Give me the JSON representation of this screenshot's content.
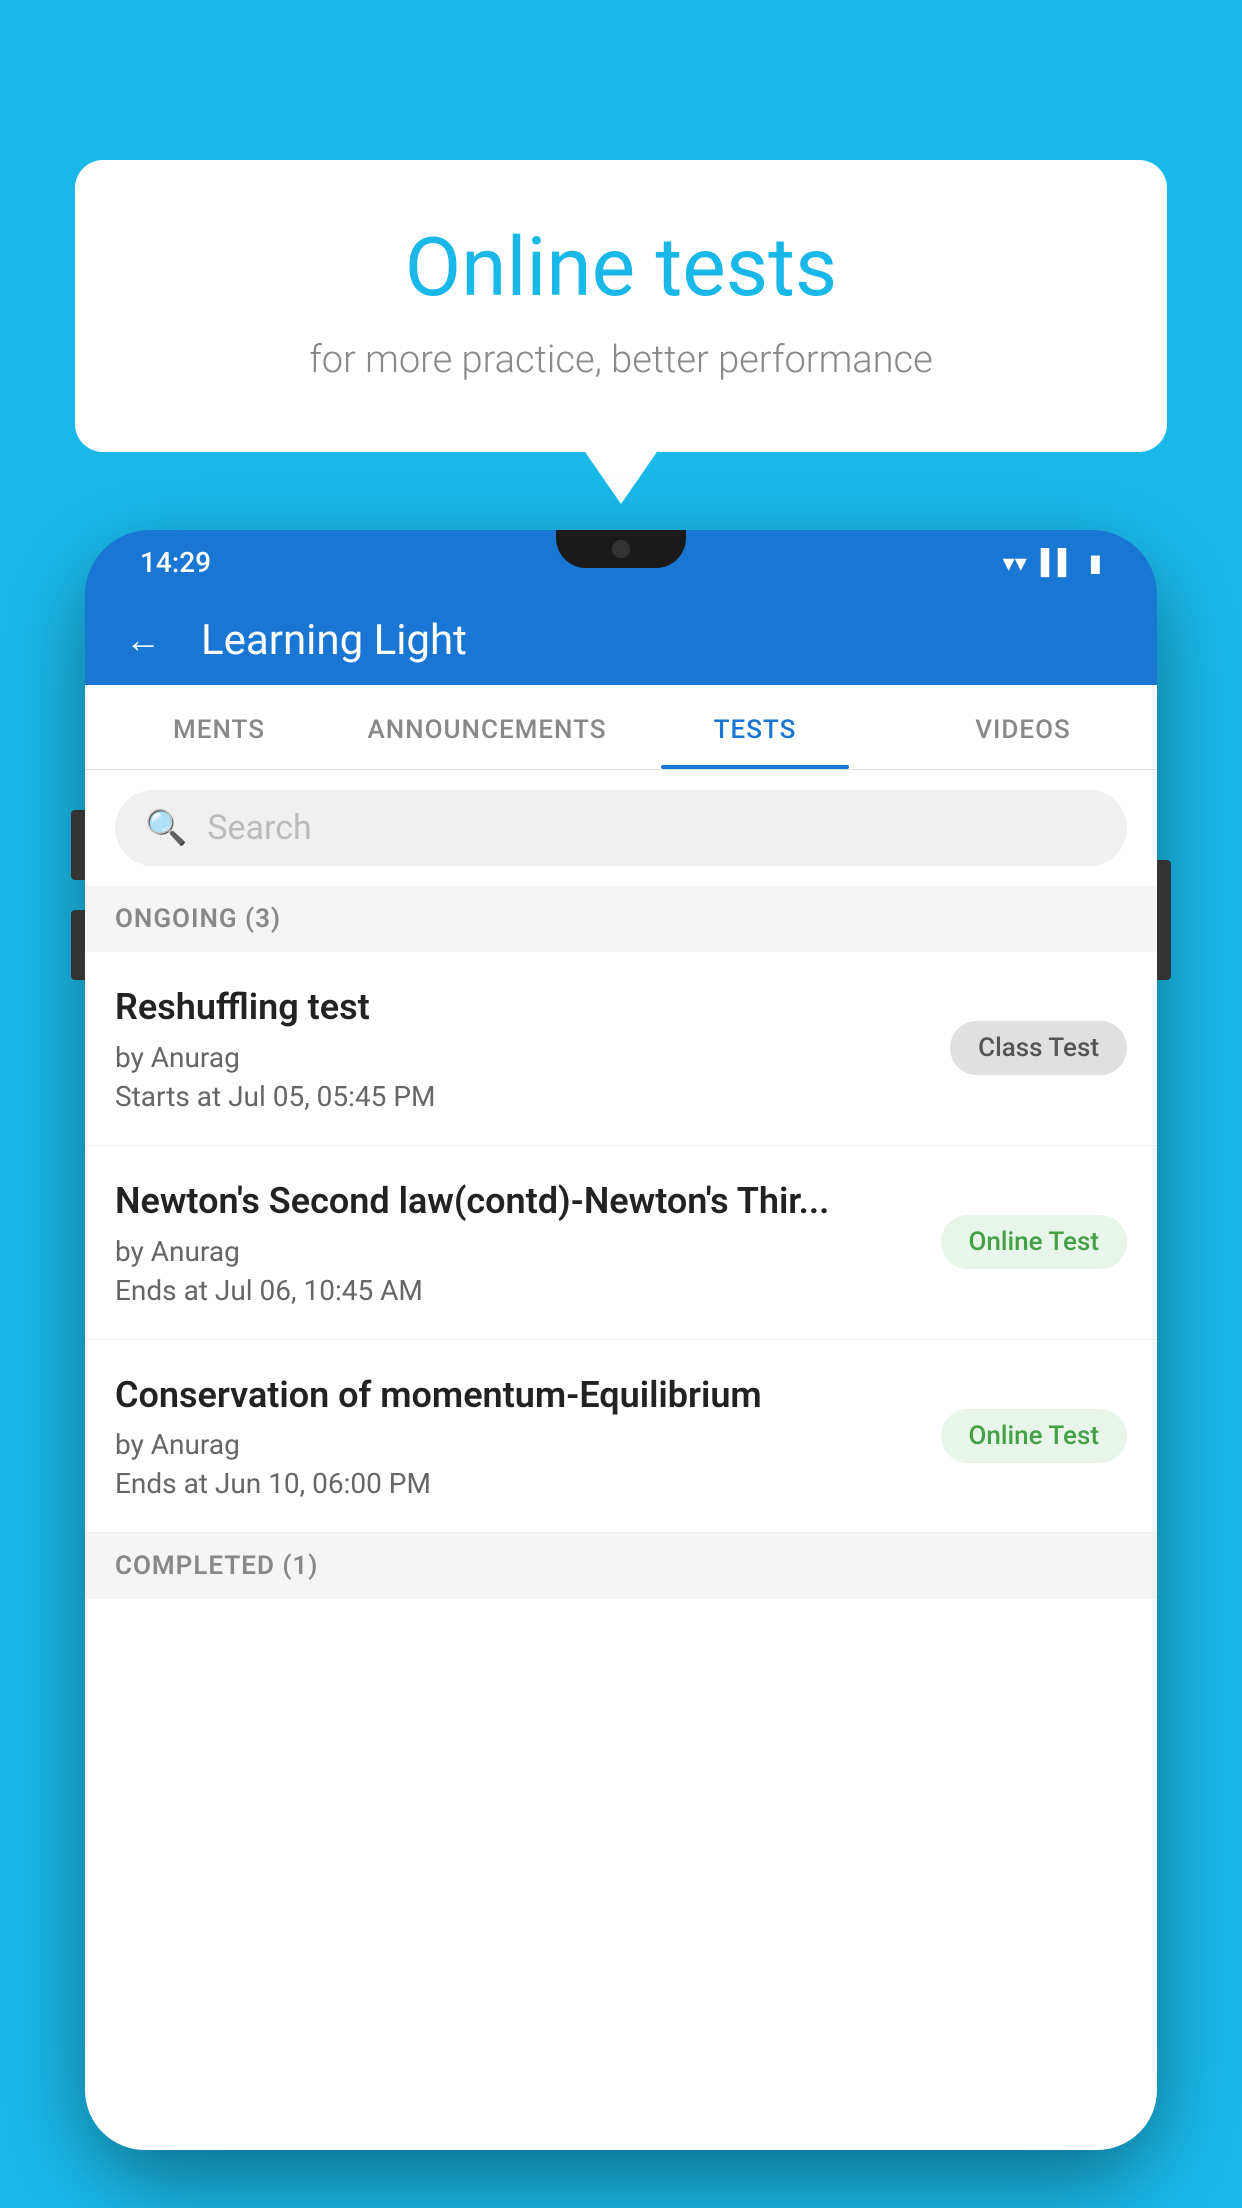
{
  "background_color": "#1ab8e8",
  "speech_bubble": {
    "title": "Online tests",
    "subtitle": "for more practice, better performance"
  },
  "phone": {
    "status_bar": {
      "time": "14:29",
      "icons": [
        "wifi",
        "signal",
        "battery"
      ]
    },
    "header": {
      "title": "Learning Light",
      "back_label": "←"
    },
    "tabs": [
      {
        "label": "MENTS",
        "active": false
      },
      {
        "label": "ANNOUNCEMENTS",
        "active": false
      },
      {
        "label": "TESTS",
        "active": true
      },
      {
        "label": "VIDEOS",
        "active": false
      }
    ],
    "search": {
      "placeholder": "Search"
    },
    "section_ongoing": "ONGOING (3)",
    "tests": [
      {
        "name": "Reshuffling test",
        "author": "by Anurag",
        "date": "Starts at  Jul 05, 05:45 PM",
        "badge": "Class Test",
        "badge_type": "class"
      },
      {
        "name": "Newton's Second law(contd)-Newton's Thir...",
        "author": "by Anurag",
        "date": "Ends at  Jul 06, 10:45 AM",
        "badge": "Online Test",
        "badge_type": "online"
      },
      {
        "name": "Conservation of momentum-Equilibrium",
        "author": "by Anurag",
        "date": "Ends at  Jun 10, 06:00 PM",
        "badge": "Online Test",
        "badge_type": "online"
      }
    ],
    "section_completed": "COMPLETED (1)"
  }
}
